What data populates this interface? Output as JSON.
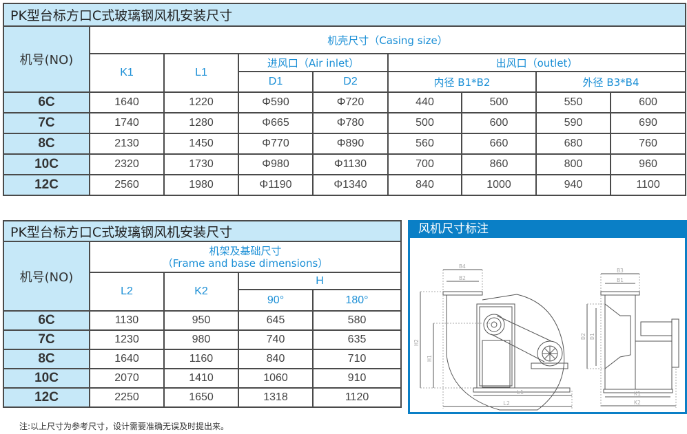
{
  "table1": {
    "title": "PK型台标方口C式玻璃钢风机安装尺寸",
    "no_header": "机号(NO)",
    "group_header": "机壳尺寸（Casing size）",
    "k1": "K1",
    "l1": "L1",
    "inlet_header": "进风口（Air inlet）",
    "outlet_header": "出风口（outlet）",
    "d1": "D1",
    "d2": "D2",
    "inner_header": "内径 B1*B2",
    "outer_header": "外径 B3*B4",
    "rows": [
      {
        "no": "6C",
        "k1": "1640",
        "l1": "1220",
        "d1": "Φ590",
        "d2": "Φ720",
        "b1": "440",
        "b2": "500",
        "b3": "550",
        "b4": "600"
      },
      {
        "no": "7C",
        "k1": "1740",
        "l1": "1280",
        "d1": "Φ665",
        "d2": "Φ780",
        "b1": "500",
        "b2": "600",
        "b3": "590",
        "b4": "690"
      },
      {
        "no": "8C",
        "k1": "2130",
        "l1": "1450",
        "d1": "Φ770",
        "d2": "Φ890",
        "b1": "560",
        "b2": "660",
        "b3": "680",
        "b4": "760"
      },
      {
        "no": "10C",
        "k1": "2320",
        "l1": "1730",
        "d1": "Φ980",
        "d2": "Φ1130",
        "b1": "700",
        "b2": "860",
        "b3": "800",
        "b4": "960"
      },
      {
        "no": "12C",
        "k1": "2560",
        "l1": "1980",
        "d1": "Φ1190",
        "d2": "Φ1340",
        "b1": "840",
        "b2": "1000",
        "b3": "940",
        "b4": "1100"
      }
    ]
  },
  "table2": {
    "title": "PK型台标方口C式玻璃钢风机安装尺寸",
    "no_header": "机号(NO)",
    "group_header_cn": "机架及基础尺寸",
    "group_header_en": "（Frame and base dimensions）",
    "l2": "L2",
    "k2": "K2",
    "h": "H",
    "h90": "90°",
    "h180": "180°",
    "rows": [
      {
        "no": "6C",
        "l2": "1130",
        "k2": "950",
        "h90": "645",
        "h180": "580"
      },
      {
        "no": "7C",
        "l2": "1230",
        "k2": "980",
        "h90": "740",
        "h180": "635"
      },
      {
        "no": "8C",
        "l2": "1640",
        "k2": "1160",
        "h90": "840",
        "h180": "710"
      },
      {
        "no": "10C",
        "l2": "2070",
        "k2": "1410",
        "h90": "1060",
        "h180": "910"
      },
      {
        "no": "12C",
        "l2": "2250",
        "k2": "1650",
        "h90": "1318",
        "h180": "1120"
      }
    ]
  },
  "diagram": {
    "title": "风机尺寸标注",
    "labels": {
      "b4": "B4",
      "b2": "B2",
      "h2": "H2",
      "h1": "H1",
      "l1": "L1",
      "l2": "L2",
      "b3": "B3",
      "b1": "B1",
      "d2": "D2",
      "d1": "D1",
      "k1": "K1",
      "k2": "K2"
    }
  },
  "note": "注:以上尺寸为参考尺寸，设计需要准确无误及时提出来。",
  "colors": {
    "header_bg": "#c6e8f8",
    "accent_blue": "#0a7fc6",
    "header_text": "#1b8fd6",
    "border": "#4a4a4a"
  }
}
